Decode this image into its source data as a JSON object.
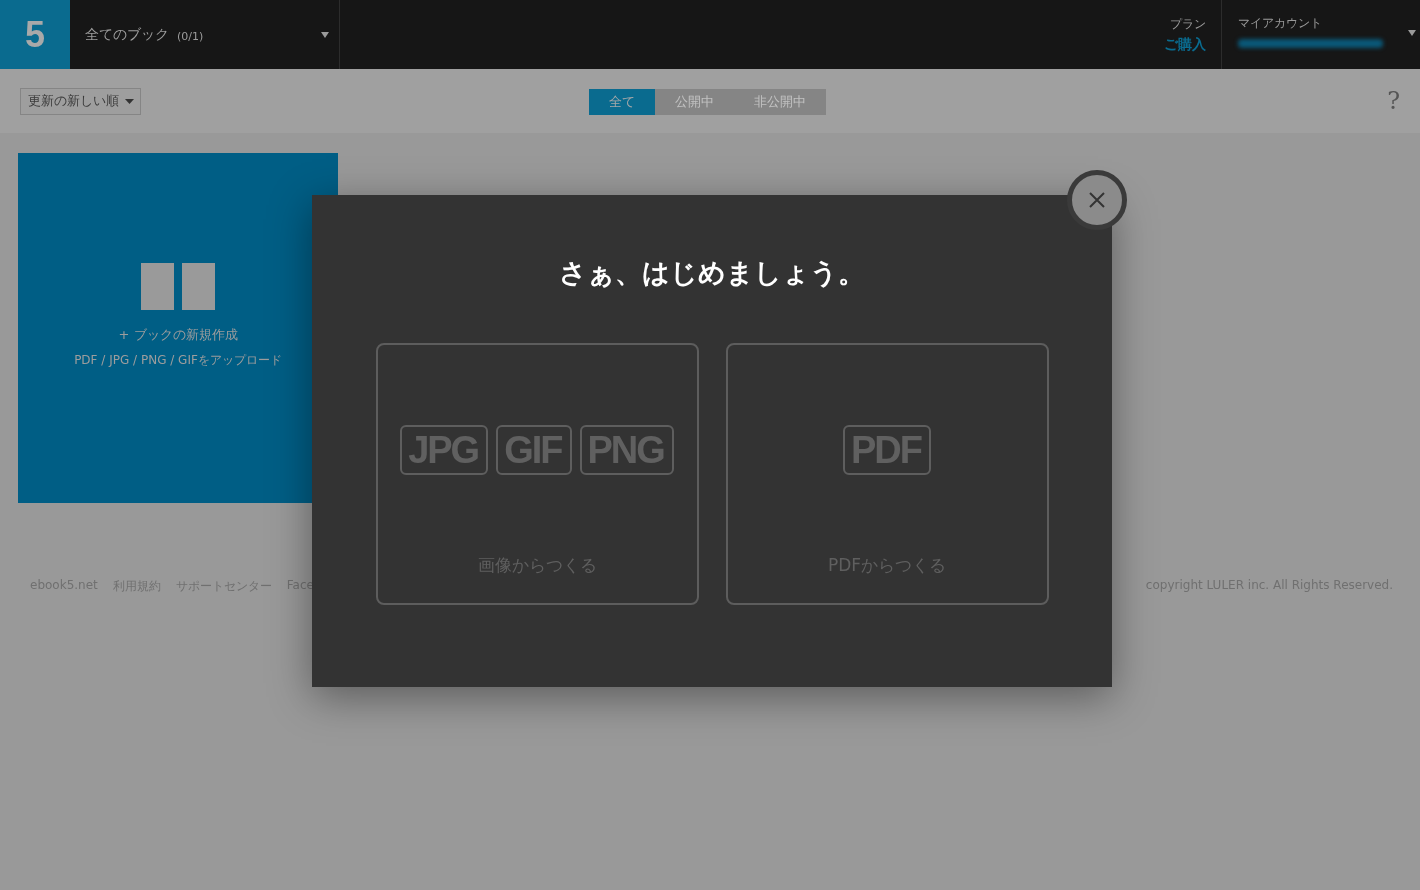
{
  "header": {
    "logo": "5",
    "book_filter": {
      "label": "全てのブック",
      "count": "(0/1)"
    },
    "plan": {
      "label": "プラン",
      "link": "ご購入"
    },
    "account": {
      "label": "マイアカウント"
    }
  },
  "toolbar": {
    "sort": {
      "label": "更新の新しい順"
    },
    "tabs": [
      {
        "label": "全て",
        "selected": true
      },
      {
        "label": "公開中",
        "selected": false
      },
      {
        "label": "非公開中",
        "selected": false
      }
    ],
    "help": "?"
  },
  "new_book": {
    "title": "+ ブックの新規作成",
    "subtitle": "PDF / JPG / PNG / GIFをアップロード"
  },
  "footer": {
    "links": [
      "ebook5.net",
      "利用規約",
      "サポートセンター",
      "Face"
    ],
    "copyright": "copyright LULER inc. All Rights Reserved."
  },
  "modal": {
    "title": "さぁ、はじめましょう。",
    "options": [
      {
        "badges": [
          "JPG",
          "GIF",
          "PNG"
        ],
        "label": "画像からつくる"
      },
      {
        "badges": [
          "PDF"
        ],
        "label": "PDFからつくる"
      }
    ]
  }
}
